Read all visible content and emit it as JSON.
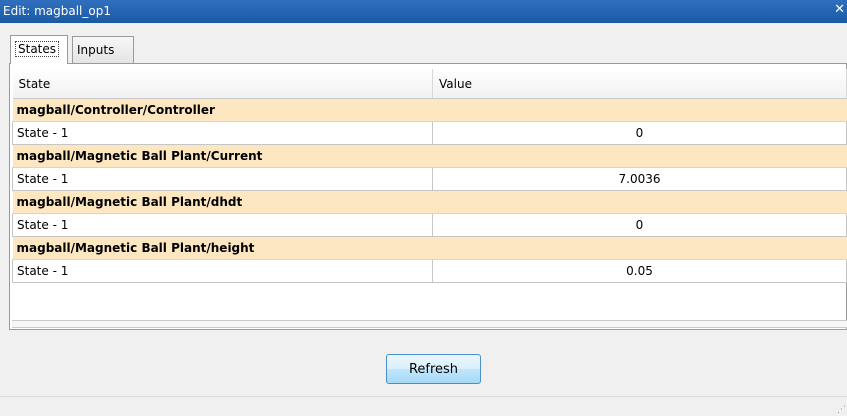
{
  "window": {
    "title": "Edit: magball_op1",
    "close_glyph": "✕"
  },
  "tabs": [
    {
      "label": "States",
      "active": true
    },
    {
      "label": "Inputs",
      "active": false
    }
  ],
  "table": {
    "columns": [
      "State",
      "Value"
    ],
    "groups": [
      {
        "name": "magball/Controller/Controller",
        "rows": [
          {
            "state": "State - 1",
            "value": "0"
          }
        ]
      },
      {
        "name": "magball/Magnetic Ball Plant/Current",
        "rows": [
          {
            "state": "State - 1",
            "value": "7.0036"
          }
        ]
      },
      {
        "name": "magball/Magnetic Ball Plant/dhdt",
        "rows": [
          {
            "state": "State - 1",
            "value": "0"
          }
        ]
      },
      {
        "name": "magball/Magnetic Ball Plant/height",
        "rows": [
          {
            "state": "State - 1",
            "value": "0.05"
          }
        ]
      }
    ]
  },
  "buttons": {
    "refresh": "Refresh"
  },
  "colors": {
    "title_bar": "#1c5aa6",
    "group_row": "#fde7c1",
    "button_border": "#4d8fc7"
  }
}
